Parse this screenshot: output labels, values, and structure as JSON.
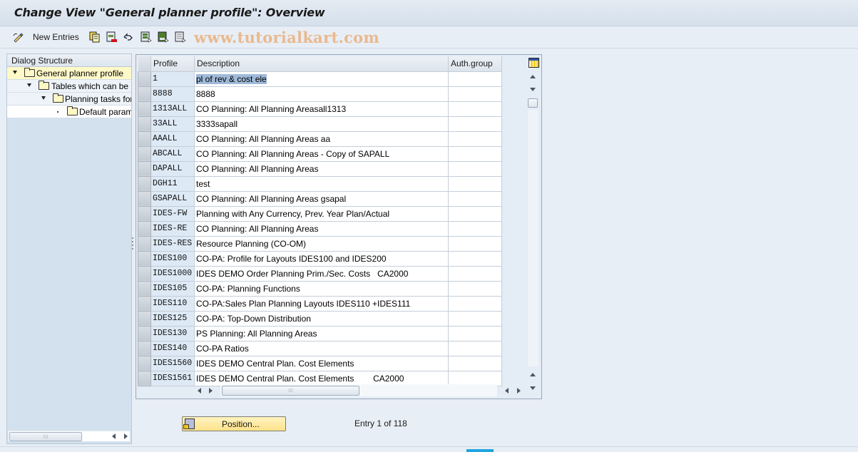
{
  "window": {
    "title": "Change View \"General planner profile\": Overview"
  },
  "toolbar": {
    "items": [
      {
        "name": "change-display-icon",
        "label": ""
      },
      {
        "name": "new-entries",
        "label": "New Entries"
      },
      {
        "name": "copy-as-icon",
        "label": ""
      },
      {
        "name": "delete-icon",
        "label": ""
      },
      {
        "name": "undo-change-icon",
        "label": ""
      },
      {
        "name": "select-all-icon",
        "label": ""
      },
      {
        "name": "select-block-icon",
        "label": ""
      },
      {
        "name": "deselect-all-icon",
        "label": ""
      }
    ],
    "watermark": "www.tutorialkart.com"
  },
  "dialog_structure": {
    "header": "Dialog Structure",
    "nodes": [
      {
        "label": "General planner profile",
        "level": 0,
        "toggle": "expanded",
        "selected": true,
        "open_folder": true
      },
      {
        "label": "Tables which can be",
        "level": 1,
        "toggle": "expanded",
        "selected": false
      },
      {
        "label": "Planning tasks for",
        "level": 2,
        "toggle": "expanded",
        "selected": false
      },
      {
        "label": "Default param",
        "level": 3,
        "toggle": "leaf",
        "selected": false
      }
    ]
  },
  "table": {
    "columns": [
      "Profile",
      "Description",
      "Auth.group"
    ],
    "rows": [
      {
        "profile": "1",
        "description": "pl of rev & cost ele",
        "auth": "",
        "highlight": true
      },
      {
        "profile": "8888",
        "description": "8888",
        "auth": ""
      },
      {
        "profile": "1313ALL",
        "description": "CO Planning: All Planning Areasall1313",
        "auth": ""
      },
      {
        "profile": "33ALL",
        "description": "3333sapall",
        "auth": ""
      },
      {
        "profile": "AAALL",
        "description": "CO Planning: All Planning Areas aa",
        "auth": ""
      },
      {
        "profile": "ABCALL",
        "description": "CO Planning: All Planning Areas - Copy of SAPALL",
        "auth": ""
      },
      {
        "profile": "DAPALL",
        "description": "CO Planning: All Planning Areas",
        "auth": ""
      },
      {
        "profile": "DGH11",
        "description": "test",
        "auth": ""
      },
      {
        "profile": "GSAPALL",
        "description": "CO Planning: All Planning Areas gsapal",
        "auth": ""
      },
      {
        "profile": "IDES-FW",
        "description": "Planning with Any Currency, Prev. Year Plan/Actual",
        "auth": ""
      },
      {
        "profile": "IDES-RE",
        "description": "CO Planning: All Planning Areas",
        "auth": ""
      },
      {
        "profile": "IDES-RES",
        "description": "Resource Planning (CO-OM)",
        "auth": ""
      },
      {
        "profile": "IDES100",
        "description": "CO-PA: Profile for Layouts IDES100 and IDES200",
        "auth": ""
      },
      {
        "profile": "IDES1000",
        "description": "IDES DEMO Order Planning Prim./Sec. Costs   CA2000",
        "auth": ""
      },
      {
        "profile": "IDES105",
        "description": "CO-PA: Planning Functions",
        "auth": ""
      },
      {
        "profile": "IDES110",
        "description": "CO-PA:Sales Plan Planning Layouts IDES110 +IDES111",
        "auth": ""
      },
      {
        "profile": "IDES125",
        "description": "CO-PA: Top-Down Distribution",
        "auth": ""
      },
      {
        "profile": "IDES130",
        "description": "PS Planning: All Planning Areas",
        "auth": ""
      },
      {
        "profile": "IDES140",
        "description": "CO-PA Ratios",
        "auth": ""
      },
      {
        "profile": "IDES1560",
        "description": "IDES DEMO Central Plan. Cost Elements",
        "auth": ""
      },
      {
        "profile": "IDES1561",
        "description": "IDES DEMO Central Plan. Cost Elements        CA2000",
        "auth": ""
      }
    ]
  },
  "footer": {
    "position_button": "Position...",
    "entry_text": "Entry 1 of 118"
  }
}
